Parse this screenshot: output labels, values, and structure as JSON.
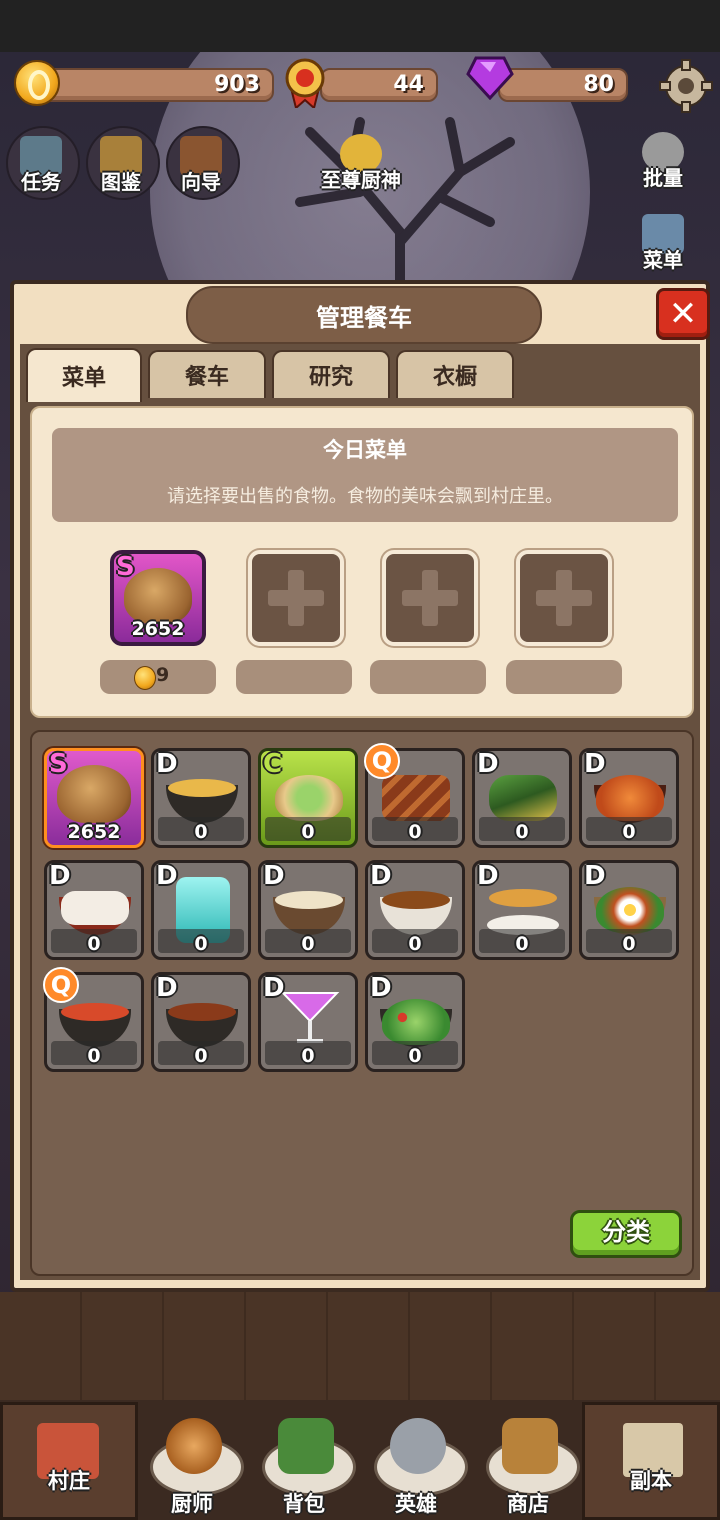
{
  "resources": {
    "coins": "903",
    "medals": "44",
    "gems": "80"
  },
  "hud": {
    "left_buttons": [
      "任务",
      "图鉴",
      "向导"
    ],
    "center_button": "至尊厨神",
    "right_buttons": [
      "批量",
      "菜单"
    ]
  },
  "panel": {
    "title": "管理餐车",
    "tabs": [
      "菜单",
      "餐车",
      "研究",
      "衣橱"
    ],
    "active_tab": "菜单",
    "menu_title": "今日菜单",
    "menu_desc": "请选择要出售的食物。食物的美味会飘到村庄里。",
    "slots": [
      {
        "grade": "S",
        "qty": "2652",
        "price": "9"
      }
    ],
    "sort_button": "分类"
  },
  "foods": [
    {
      "grade": "S",
      "qty": "2652"
    },
    {
      "grade": "D",
      "qty": "0"
    },
    {
      "grade": "C",
      "qty": "0"
    },
    {
      "grade": "Q",
      "qty": "0"
    },
    {
      "grade": "D",
      "qty": "0"
    },
    {
      "grade": "D",
      "qty": "0"
    },
    {
      "grade": "D",
      "qty": "0"
    },
    {
      "grade": "D",
      "qty": "0"
    },
    {
      "grade": "D",
      "qty": "0"
    },
    {
      "grade": "D",
      "qty": "0"
    },
    {
      "grade": "D",
      "qty": "0"
    },
    {
      "grade": "D",
      "qty": "0"
    },
    {
      "grade": "Q",
      "qty": "0"
    },
    {
      "grade": "D",
      "qty": "0"
    },
    {
      "grade": "D",
      "qty": "0"
    },
    {
      "grade": "D",
      "qty": "0"
    }
  ],
  "bottom_nav": [
    "村庄",
    "厨师",
    "背包",
    "英雄",
    "商店",
    "副本"
  ]
}
